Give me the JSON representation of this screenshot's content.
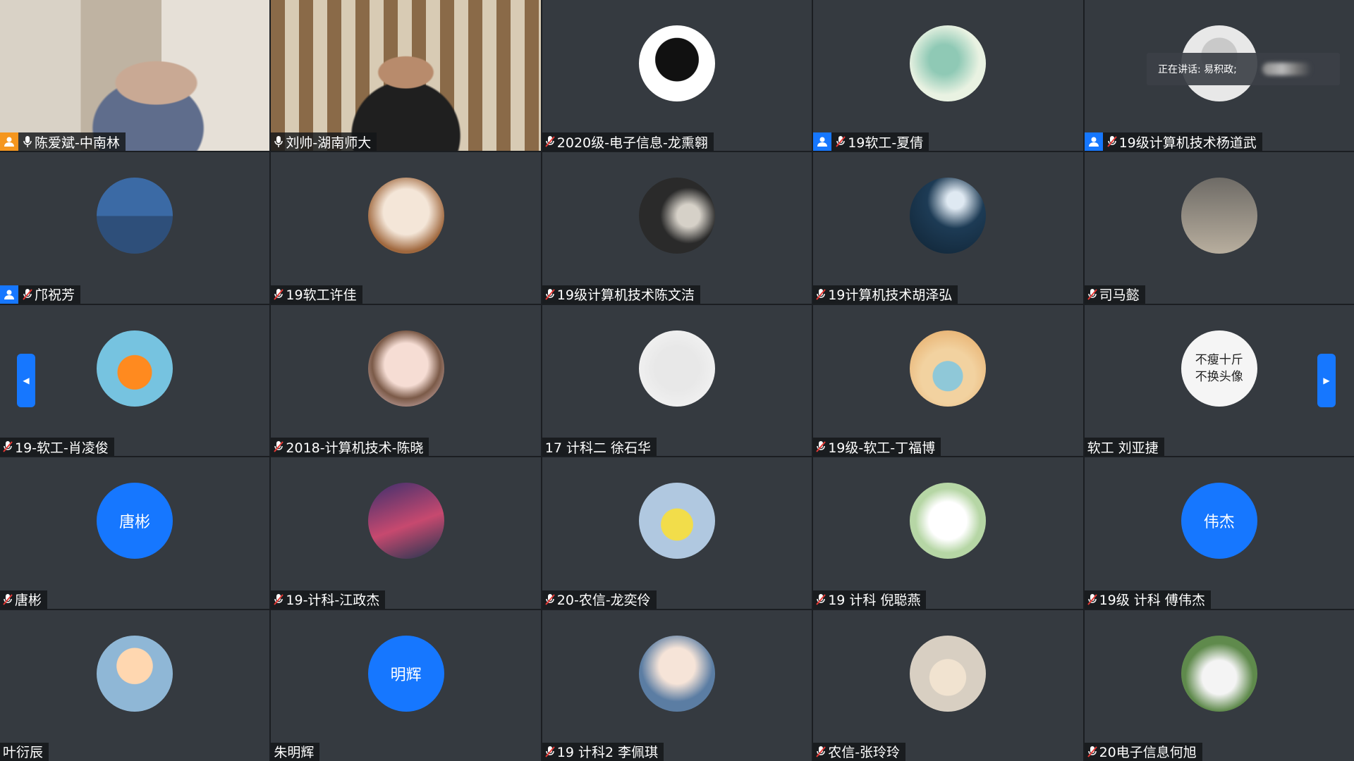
{
  "speaking_label": "正在讲话: 易积政;",
  "nav": {
    "prev_symbol": "◀",
    "next_symbol": "▶"
  },
  "colors": {
    "accent": "#1677ff",
    "host_badge_orange": "#f5961e",
    "tile_bg": "#353a40"
  },
  "participants": [
    {
      "name": "陈爱斌-中南林",
      "host": "orange",
      "mic": "on",
      "avatar": "video-1"
    },
    {
      "name": "刘帅-湖南师大",
      "host": "",
      "mic": "on",
      "avatar": "video-2"
    },
    {
      "name": "2020级-电子信息-龙熏翱",
      "host": "",
      "mic": "muted",
      "avatar": "image"
    },
    {
      "name": "19软工-夏倩",
      "host": "blue",
      "mic": "muted",
      "avatar": "image"
    },
    {
      "name": "19级计算机技术杨道武",
      "host": "blue",
      "mic": "muted",
      "avatar": "image"
    },
    {
      "name": "邝祝芳",
      "host": "blue",
      "mic": "muted",
      "avatar": "image"
    },
    {
      "name": "19软工许佳",
      "host": "",
      "mic": "muted",
      "avatar": "image"
    },
    {
      "name": "19级计算机技术陈文洁",
      "host": "",
      "mic": "muted",
      "avatar": "image"
    },
    {
      "name": "19计算机技术胡泽弘",
      "host": "",
      "mic": "muted",
      "avatar": "image"
    },
    {
      "name": "司马懿",
      "host": "",
      "mic": "muted",
      "avatar": "image"
    },
    {
      "name": "19-软工-肖凌俊",
      "host": "",
      "mic": "muted",
      "avatar": "image"
    },
    {
      "name": "2018-计算机技术-陈晓",
      "host": "",
      "mic": "muted",
      "avatar": "image"
    },
    {
      "name": "17 计科二 徐石华",
      "host": "",
      "mic": "none",
      "avatar": "image"
    },
    {
      "name": "19级-软工-丁福博",
      "host": "",
      "mic": "muted",
      "avatar": "image"
    },
    {
      "name": "软工 刘亚捷",
      "host": "",
      "mic": "none",
      "avatar": "image",
      "avatar_text": "不瘦十斤 不换头像"
    },
    {
      "name": "唐彬",
      "host": "",
      "mic": "muted",
      "avatar": "text",
      "avatar_text": "唐彬"
    },
    {
      "name": "19-计科-江政杰",
      "host": "",
      "mic": "muted",
      "avatar": "image"
    },
    {
      "name": "20-农信-龙奕伶",
      "host": "",
      "mic": "muted",
      "avatar": "image"
    },
    {
      "name": "19 计科 倪聪燕",
      "host": "",
      "mic": "muted",
      "avatar": "image"
    },
    {
      "name": "19级 计科 傅伟杰",
      "host": "",
      "mic": "muted",
      "avatar": "text",
      "avatar_text": "伟杰"
    },
    {
      "name": "叶衍辰",
      "host": "",
      "mic": "none",
      "avatar": "image"
    },
    {
      "name": "朱明辉",
      "host": "",
      "mic": "none",
      "avatar": "text",
      "avatar_text": "明辉"
    },
    {
      "name": "19 计科2 李佩琪",
      "host": "",
      "mic": "muted",
      "avatar": "image"
    },
    {
      "name": "农信-张玲玲",
      "host": "",
      "mic": "muted",
      "avatar": "image"
    },
    {
      "name": "20电子信息何旭",
      "host": "",
      "mic": "muted",
      "avatar": "image"
    }
  ]
}
